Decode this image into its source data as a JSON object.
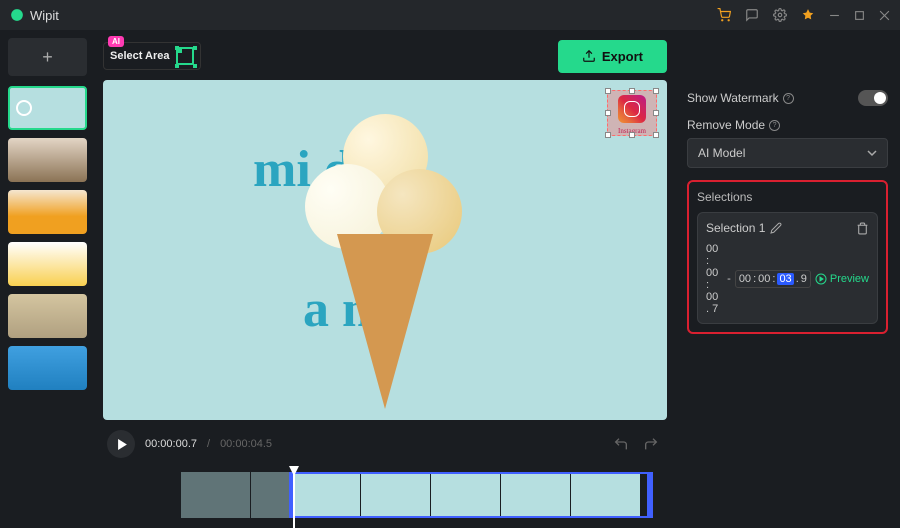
{
  "app": {
    "name": "Wipit"
  },
  "toolbar": {
    "ai_badge": "AI",
    "select_area_label": "Select Area",
    "export_label": "Export"
  },
  "preview": {
    "watermark_label": "Instagram",
    "bg_text_top": "mi    d",
    "bg_text_bottom": "a   n"
  },
  "playback": {
    "current": "00:00:00.7",
    "separator": "/",
    "duration": "00:00:04.5"
  },
  "right": {
    "show_watermark_label": "Show Watermark",
    "show_watermark_on": true,
    "remove_mode_label": "Remove Mode",
    "mode_value": "AI Model",
    "selections_label": "Selections",
    "selection": {
      "name": "Selection 1",
      "start": "00 : 00 : 00 . 7",
      "dash": "-",
      "end_hh": "00",
      "end_mm": "00",
      "end_ss": "03",
      "end_d": "9",
      "preview_label": "Preview"
    }
  },
  "thumbs": [
    "ice-cream",
    "couch",
    "food",
    "splash",
    "shirt",
    "people"
  ]
}
